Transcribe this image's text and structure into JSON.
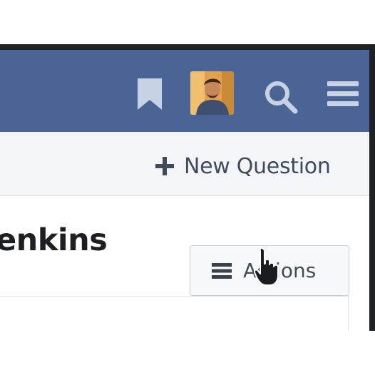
{
  "header": {
    "bookmark_icon": "bookmark-icon",
    "avatar_icon": "user-avatar",
    "search_icon": "search-icon",
    "menu_icon": "hamburger-menu-icon",
    "bar_color": "#4a6595"
  },
  "toolbar": {
    "new_question_label": "New Question",
    "new_question_icon": "plus-icon"
  },
  "main": {
    "title": "enkins",
    "actions_label": "Actions",
    "actions_icon": "hamburger-list-icon"
  },
  "pointer": {
    "icon": "hand-pointer-cursor"
  }
}
